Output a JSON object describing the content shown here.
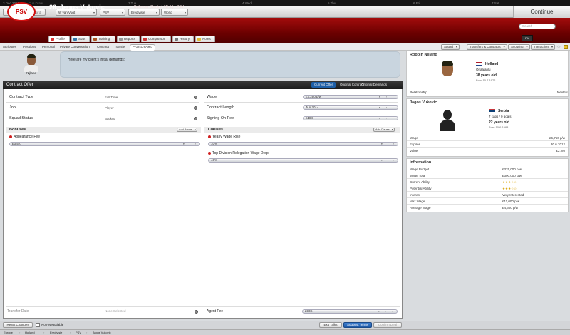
{
  "topbar": {
    "date": "3 Dec 2013",
    "sub": "Cup Draw",
    "days": [
      "3 Tue",
      "4 Wed",
      "5 Thu",
      "6 Fri",
      "7 Sat"
    ]
  },
  "nav": {
    "back": "Back",
    "forward": "Forward",
    "manager": "W van Vugt",
    "club": "PSV",
    "division": "Eredivisie",
    "nation": "World",
    "continue": "Continue",
    "search_placeholder": "Search"
  },
  "header": {
    "title": "26. Jagos Vukovic",
    "subtitle": "Defender (Centre) / D (L) - PSV",
    "crest": "PSV",
    "logo": "FM",
    "tabs": [
      "Profile",
      "Stats",
      "Training",
      "Reports",
      "Comparison",
      "History",
      "Notes"
    ]
  },
  "subnav": {
    "items": [
      "Attributes",
      "Positions",
      "Personal",
      "Private Conversation",
      "Contract",
      "Transfer",
      "Contract Offer"
    ],
    "buttons": [
      "Squad",
      "Transfers & Contracts",
      "Scouting",
      "Interaction"
    ]
  },
  "agent": {
    "name": "Nijland",
    "message": "Here are my client's initial demands:"
  },
  "offer": {
    "title": "Contract Offer",
    "tabs": [
      "Current Offer",
      "Original Contract",
      "Original Demands"
    ],
    "left_rows": [
      {
        "label": "Contract Type",
        "value": "Full Time"
      },
      {
        "label": "Job",
        "value": "Player"
      },
      {
        "label": "Squad Status",
        "value": "Backup"
      }
    ],
    "right_rows": [
      {
        "label": "Wage",
        "value": "£7,250 p/w"
      },
      {
        "label": "Contract Length",
        "value": "Jun 2014"
      },
      {
        "label": "Signing On Fee",
        "value": "£18K"
      }
    ],
    "bonuses": {
      "title": "Bonuses",
      "add": "Add Bonus",
      "items": [
        {
          "label": "Appearance Fee",
          "value": "£3.5K"
        }
      ]
    },
    "clauses": {
      "title": "Clauses",
      "add": "Add Clause",
      "items": [
        {
          "label": "Yearly Wage Rise",
          "value": "10%"
        },
        {
          "label": "Top Division Relegation Wage Drop",
          "value": "40%"
        }
      ]
    },
    "transfer_date": {
      "label": "Transfer Date",
      "value": "None Selected"
    },
    "agent_fee": {
      "label": "Agent Fee",
      "value": "£90K"
    }
  },
  "agent_card": {
    "title": "Robbin Nijland",
    "nation": "Holland",
    "role": "Onaajanlu",
    "age": "38 years old",
    "born": "Born 10.7.1972",
    "relationship_label": "Relationship",
    "relationship": "Neutral"
  },
  "player_card": {
    "title": "Jagos Vukovic",
    "nation": "Serbia",
    "caps": "7 caps / 0 goals",
    "age": "22 years old",
    "born": "Born 10.6.1988",
    "rows": [
      {
        "label": "Wage",
        "value": "£6,750 p/w"
      },
      {
        "label": "Expires",
        "value": "30.6.2012"
      },
      {
        "label": "Value",
        "value": "£2.2M"
      }
    ]
  },
  "info": {
    "title": "Information",
    "rows": [
      {
        "label": "Wage Budget",
        "value": "£325,000 p/w"
      },
      {
        "label": "Wage Total",
        "value": "£300,000 p/w"
      },
      {
        "label": "Current Ability",
        "value": "★★★☆☆"
      },
      {
        "label": "Potential Ability",
        "value": "★★★☆☆"
      },
      {
        "label": "Interest",
        "value": "Very Interested"
      },
      {
        "label": "Max Wage",
        "value": "£11,000 p/w"
      },
      {
        "label": "Average Wage",
        "value": "£4,600 p/w"
      }
    ]
  },
  "bottom": {
    "reset": "Reset Changes",
    "non_negotiable": "Non-Negotiable",
    "exit": "Exit Talks",
    "suggest": "Suggest Terms",
    "confirm": "Confirm Deal"
  },
  "status": [
    "Europe",
    "Holland",
    "Eredivisie",
    "PSV",
    "Jagos Vukovic"
  ]
}
